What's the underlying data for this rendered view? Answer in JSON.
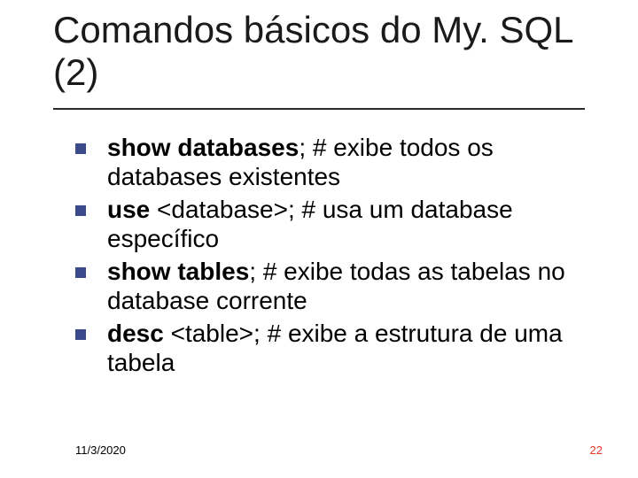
{
  "title": "Comandos básicos do My. SQL (2)",
  "items": [
    {
      "bold": "show databases",
      "rest": "; # exibe todos os databases existentes"
    },
    {
      "bold": "use",
      "rest": " <database>; # usa um database específico"
    },
    {
      "bold": "show tables",
      "rest": "; # exibe todas as tabelas no database corrente"
    },
    {
      "bold": "desc",
      "rest": " <table>; # exibe a estrutura de uma tabela"
    }
  ],
  "footer": {
    "date": "11/3/2020",
    "page": "22"
  }
}
